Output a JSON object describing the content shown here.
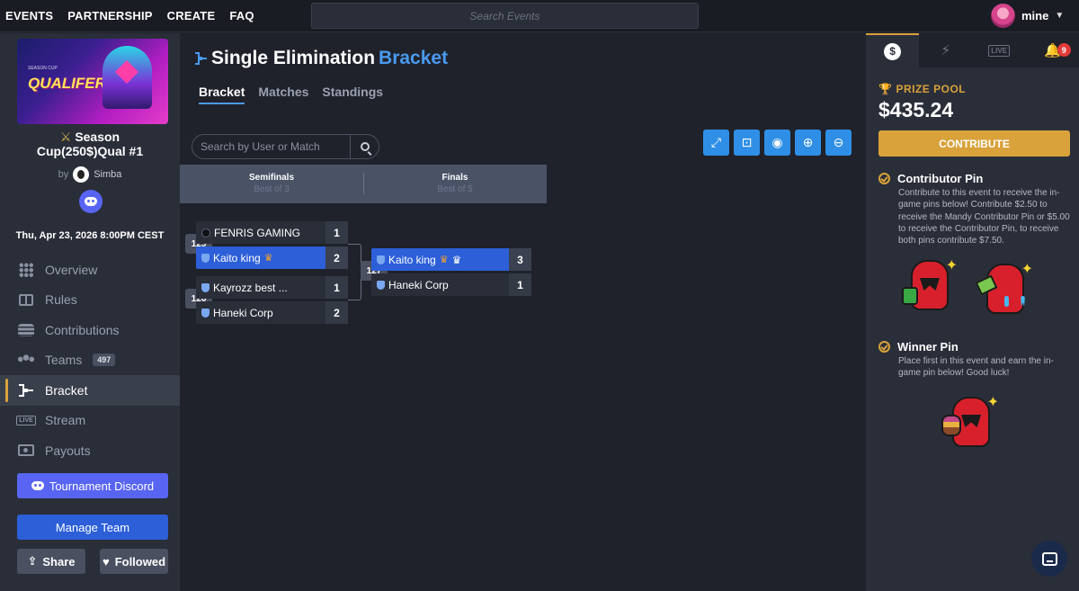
{
  "topnav": {
    "items": [
      "EVENTS",
      "PARTNERSHIP",
      "CREATE",
      "FAQ"
    ],
    "search_placeholder": "Search Events",
    "user_name": "mine"
  },
  "event": {
    "banner_small": "SEASON CUP",
    "banner_title": "QUALIFER #1",
    "title_line1": "Season",
    "title_line2": "Cup(250$)Qual #1",
    "by_label": "by",
    "organizer": "Simba",
    "date": "Thu, Apr 23, 2026 8:00PM CEST"
  },
  "sidebar": {
    "items": [
      {
        "label": "Overview",
        "icon": "grid-icon"
      },
      {
        "label": "Rules",
        "icon": "book-icon"
      },
      {
        "label": "Contributions",
        "icon": "coins-icon"
      },
      {
        "label": "Teams",
        "icon": "team-icon",
        "badge": "497"
      },
      {
        "label": "Bracket",
        "icon": "bracket-icon",
        "active": true
      },
      {
        "label": "Stream",
        "icon": "live-icon"
      },
      {
        "label": "Payouts",
        "icon": "payout-icon"
      }
    ],
    "live_icon_text": "LIVE",
    "btn_discord": "Tournament Discord",
    "btn_manage": "Manage Team",
    "btn_share": "Share",
    "btn_followed": "Followed"
  },
  "main": {
    "title_part1": "Single Elimination",
    "title_part2": "Bracket",
    "tabs": [
      "Bracket",
      "Matches",
      "Standings"
    ],
    "search_placeholder": "Search by User or Match",
    "controls": [
      "fullscreen-icon",
      "focus-icon",
      "eye-icon",
      "zoom-in-icon",
      "zoom-out-icon"
    ],
    "rounds": [
      {
        "name": "Semifinals",
        "best_of": "Best of 3"
      },
      {
        "name": "Finals",
        "best_of": "Best of 5"
      }
    ]
  },
  "bracket": {
    "matches": [
      {
        "id": "125",
        "teams": [
          {
            "name": "FENRIS GAMING",
            "score": "1",
            "winner": false
          },
          {
            "name": "Kaito king",
            "score": "2",
            "winner": true
          }
        ]
      },
      {
        "id": "126",
        "teams": [
          {
            "name": "Kayrozz best ...",
            "score": "1",
            "winner": false
          },
          {
            "name": "Haneki Corp",
            "score": "2",
            "winner": false
          }
        ]
      },
      {
        "id": "127",
        "teams": [
          {
            "name": "Kaito king",
            "score": "3",
            "winner": true
          },
          {
            "name": "Haneki Corp",
            "score": "1",
            "winner": false
          }
        ]
      }
    ]
  },
  "right_panel": {
    "tabs": [
      "prize-icon",
      "lightning-icon",
      "live-icon",
      "bell-icon"
    ],
    "live_tab_text": "LIVE",
    "notif_count": "9",
    "prize_label": "PRIZE POOL",
    "prize_amount": "$435.24",
    "contribute_label": "CONTRIBUTE",
    "contributor_pin_title": "Contributor Pin",
    "contributor_pin_desc": "Contribute to this event to receive the in-game pins below! Contribute $2.50 to receive the Mandy Contributor Pin or $5.00 to receive the Contributor Pin, to receive both pins contribute $7.50.",
    "winner_pin_title": "Winner Pin",
    "winner_pin_desc": "Place first in this event and earn the in-game pin below! Good luck!"
  },
  "colors": {
    "accent_blue": "#4a9af0",
    "gold": "#d9a23a",
    "winner_blue": "#2c5fd8",
    "discord": "#5865f2"
  }
}
